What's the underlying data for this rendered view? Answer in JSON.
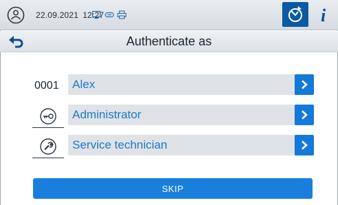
{
  "statusbar": {
    "date": "22.09.2021",
    "time": "12:27",
    "status_icons": [
      "display-icon",
      "key-icon",
      "printer-icon"
    ],
    "logo_icon": "melag-logo-icon",
    "active_tab_icon": "device-status-icon",
    "info_label": "i"
  },
  "header": {
    "back_icon": "back-arrow-icon",
    "title": "Authenticate as"
  },
  "users": [
    {
      "id": "0001",
      "name": "Alex"
    },
    {
      "icon": "key-icon",
      "name": "Administrator"
    },
    {
      "icon": "wrench-icon",
      "name": "Service technician"
    }
  ],
  "actions": {
    "skip_label": "SKIP"
  },
  "colors": {
    "accent": "#1479d8",
    "label_blue": "#1d78c9",
    "active_tab": "#0b5aa3",
    "row_bg": "#dfe3e7"
  }
}
